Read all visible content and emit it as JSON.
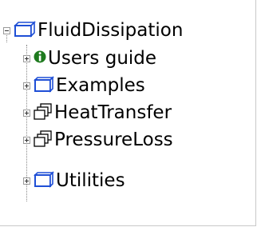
{
  "tree": {
    "root": {
      "label": "FluidDissipation",
      "expander": "collapse",
      "icon": "package-icon",
      "color": "#1f4fd6"
    },
    "children": [
      {
        "label": "Users guide",
        "expander": "expand",
        "icon": "info-icon",
        "color": "#1e7a1e"
      },
      {
        "label": "Examples",
        "expander": "expand",
        "icon": "package-outline-icon",
        "color": "#1f4fd6"
      },
      {
        "label": "HeatTransfer",
        "expander": "expand",
        "icon": "library-icon",
        "color": "#000000"
      },
      {
        "label": "PressureLoss",
        "expander": "expand",
        "icon": "library-icon",
        "color": "#000000"
      },
      {
        "label": "Utilities",
        "expander": "expand",
        "icon": "package-icon",
        "color": "#1f4fd6"
      }
    ]
  }
}
